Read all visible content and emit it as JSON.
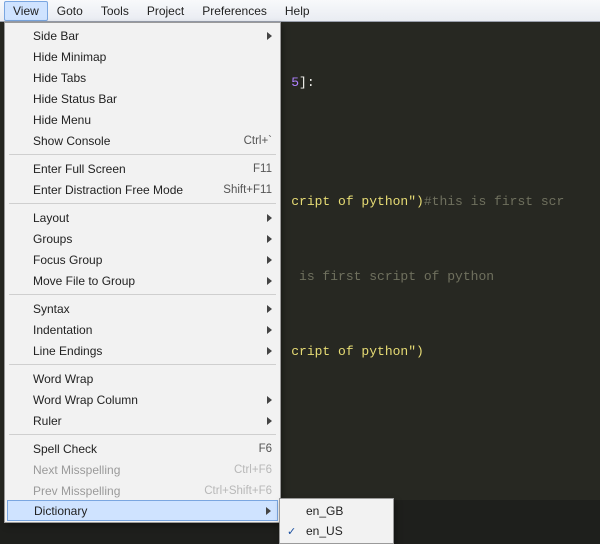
{
  "menubar": {
    "items": [
      "View",
      "Goto",
      "Tools",
      "Project",
      "Preferences",
      "Help"
    ],
    "active_index": 0
  },
  "editor": {
    "frag_num": "5",
    "frag_bracket_close": "]:",
    "line2_str": "cript of python\")",
    "line2_cmt": "#this is first scr",
    "line3_cmt": " is first script of python",
    "line4_str": "cript of python\")"
  },
  "view_menu": [
    {
      "type": "item",
      "label": "Side Bar",
      "submenu": true
    },
    {
      "type": "item",
      "label": "Hide Minimap"
    },
    {
      "type": "item",
      "label": "Hide Tabs"
    },
    {
      "type": "item",
      "label": "Hide Status Bar"
    },
    {
      "type": "item",
      "label": "Hide Menu"
    },
    {
      "type": "item",
      "label": "Show Console",
      "shortcut": "Ctrl+`"
    },
    {
      "type": "sep"
    },
    {
      "type": "item",
      "label": "Enter Full Screen",
      "shortcut": "F11"
    },
    {
      "type": "item",
      "label": "Enter Distraction Free Mode",
      "shortcut": "Shift+F11"
    },
    {
      "type": "sep"
    },
    {
      "type": "item",
      "label": "Layout",
      "submenu": true
    },
    {
      "type": "item",
      "label": "Groups",
      "submenu": true
    },
    {
      "type": "item",
      "label": "Focus Group",
      "submenu": true
    },
    {
      "type": "item",
      "label": "Move File to Group",
      "submenu": true
    },
    {
      "type": "sep"
    },
    {
      "type": "item",
      "label": "Syntax",
      "submenu": true
    },
    {
      "type": "item",
      "label": "Indentation",
      "submenu": true
    },
    {
      "type": "item",
      "label": "Line Endings",
      "submenu": true
    },
    {
      "type": "sep"
    },
    {
      "type": "item",
      "label": "Word Wrap"
    },
    {
      "type": "item",
      "label": "Word Wrap Column",
      "submenu": true
    },
    {
      "type": "item",
      "label": "Ruler",
      "submenu": true
    },
    {
      "type": "sep"
    },
    {
      "type": "item",
      "label": "Spell Check",
      "shortcut": "F6"
    },
    {
      "type": "item",
      "label": "Next Misspelling",
      "shortcut": "Ctrl+F6",
      "disabled": true
    },
    {
      "type": "item",
      "label": "Prev Misspelling",
      "shortcut": "Ctrl+Shift+F6",
      "disabled": true
    },
    {
      "type": "item",
      "label": "Dictionary",
      "submenu": true,
      "highlight": true
    }
  ],
  "dictionary_submenu": [
    {
      "label": "en_GB",
      "checked": false
    },
    {
      "label": "en_US",
      "checked": true
    }
  ]
}
